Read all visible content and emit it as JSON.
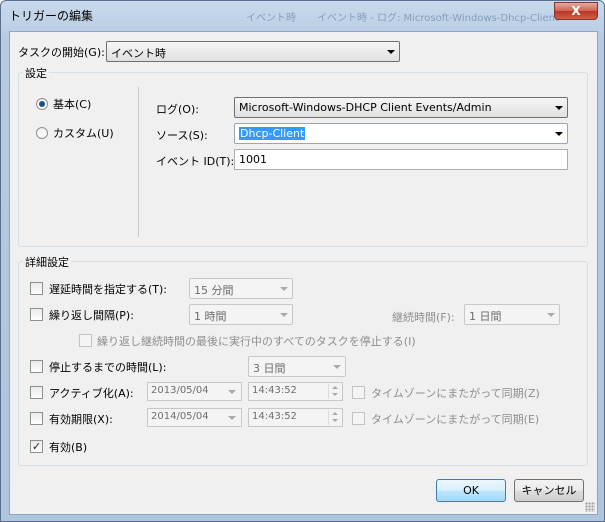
{
  "window": {
    "title": "トリガーの編集",
    "close_glyph": "X",
    "bg_titles": [
      "イベント時",
      "イベント時 - ログ: Microsoft-Windows-Dhcp-Client"
    ]
  },
  "start_task": {
    "label": "タスクの開始(G):",
    "value": "イベント時"
  },
  "settings": {
    "group_title": "設定",
    "mode_basic": "基本(C)",
    "mode_custom": "カスタム(U)",
    "selected_mode": "basic",
    "log_label": "ログ(O):",
    "log_value": "Microsoft-Windows-DHCP Client Events/Admin",
    "source_label": "ソース(S):",
    "source_value": "Dhcp-Client",
    "event_id_label": "イベント ID(T):",
    "event_id_value": "1001"
  },
  "advanced": {
    "group_title": "詳細設定",
    "delay": {
      "label": "遅延時間を指定する(T):",
      "value": "15 分間",
      "checked": false
    },
    "repeat": {
      "label": "繰り返し間隔(P):",
      "value": "1 時間",
      "checked": false,
      "duration_label": "継続時間(F):",
      "duration_value": "1 日間"
    },
    "stop_running": {
      "label": "繰り返し継続時間の最後に実行中のすべてのタスクを停止する(I)",
      "checked": false
    },
    "stop_after": {
      "label": "停止するまでの時間(L):",
      "value": "3 日間",
      "checked": false
    },
    "activate": {
      "label": "アクティブ化(A):",
      "date": "2013/05/04",
      "time": "14:43:52",
      "checked": false,
      "sync_label": "タイムゾーンにまたがって同期(Z)"
    },
    "expire": {
      "label": "有効期限(X):",
      "date": "2014/05/04",
      "time": "14:43:52",
      "checked": false,
      "sync_label": "タイムゾーンにまたがって同期(E)"
    },
    "enabled": {
      "label": "有効(B)",
      "checked": true
    }
  },
  "buttons": {
    "ok": "OK",
    "cancel": "キャンセル"
  },
  "colors": {
    "selection": "#3399ff",
    "title_gradient_top": "#c9d9ec",
    "close_red": "#c8453a"
  }
}
